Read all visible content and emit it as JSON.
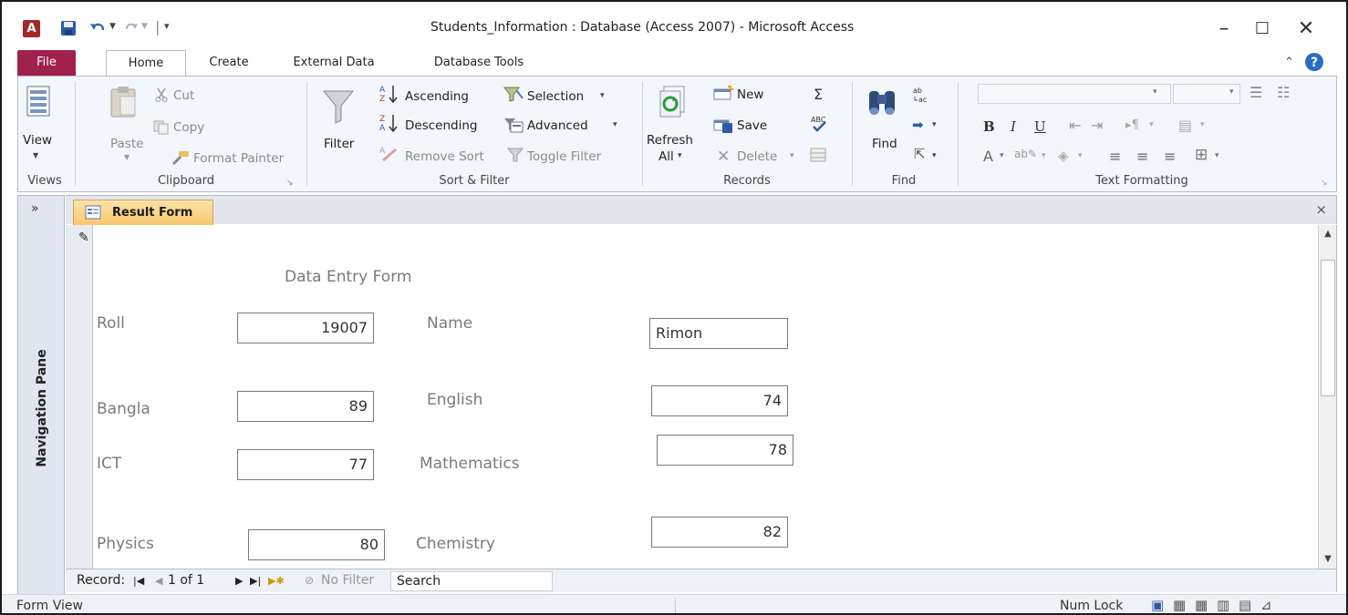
{
  "window": {
    "app_icon": "A",
    "title": "Students_Information : Database (Access 2007)  -  Microsoft Access"
  },
  "tabs": {
    "file": "File",
    "home": "Home",
    "create": "Create",
    "external": "External Data",
    "dbtools": "Database Tools"
  },
  "ribbon": {
    "views": {
      "view": "View",
      "label": "Views"
    },
    "clipboard": {
      "paste": "Paste",
      "cut": "Cut",
      "copy": "Copy",
      "format_painter": "Format Painter",
      "label": "Clipboard"
    },
    "sort": {
      "filter": "Filter",
      "ascending": "Ascending",
      "descending": "Descending",
      "remove_sort": "Remove Sort",
      "selection": "Selection",
      "advanced": "Advanced",
      "toggle_filter": "Toggle Filter",
      "label": "Sort & Filter"
    },
    "records": {
      "refresh": "Refresh",
      "refresh_all": "All",
      "new": "New",
      "save": "Save",
      "delete": "Delete",
      "label": "Records"
    },
    "find": {
      "find": "Find",
      "label": "Find"
    },
    "text": {
      "label": "Text Formatting",
      "bold": "B",
      "italic": "I",
      "underline": "U"
    }
  },
  "nav": {
    "label": "Navigation Pane",
    "chevron": "»"
  },
  "doc": {
    "tab": "Result Form",
    "close": "×"
  },
  "form": {
    "heading": "Data Entry Form",
    "roll_label": "Roll",
    "roll": "19007",
    "name_label": "Name",
    "name": "Rimon",
    "bangla_label": "Bangla",
    "bangla": "89",
    "english_label": "English",
    "english": "74",
    "ict_label": "ICT",
    "ict": "77",
    "math_label": "Mathematics",
    "math": "78",
    "physics_label": "Physics",
    "physics": "80",
    "chem_label": "Chemistry",
    "chem": "82"
  },
  "recordbar": {
    "record": "Record:",
    "position": "1 of 1",
    "no_filter": "No Filter",
    "search": "Search"
  },
  "status": {
    "view": "Form View",
    "numlock": "Num Lock"
  },
  "colors": {
    "file_tab": "#a0204e",
    "doc_tab": "#f9c76f",
    "ribbon_bg": "#f3f6fb"
  }
}
